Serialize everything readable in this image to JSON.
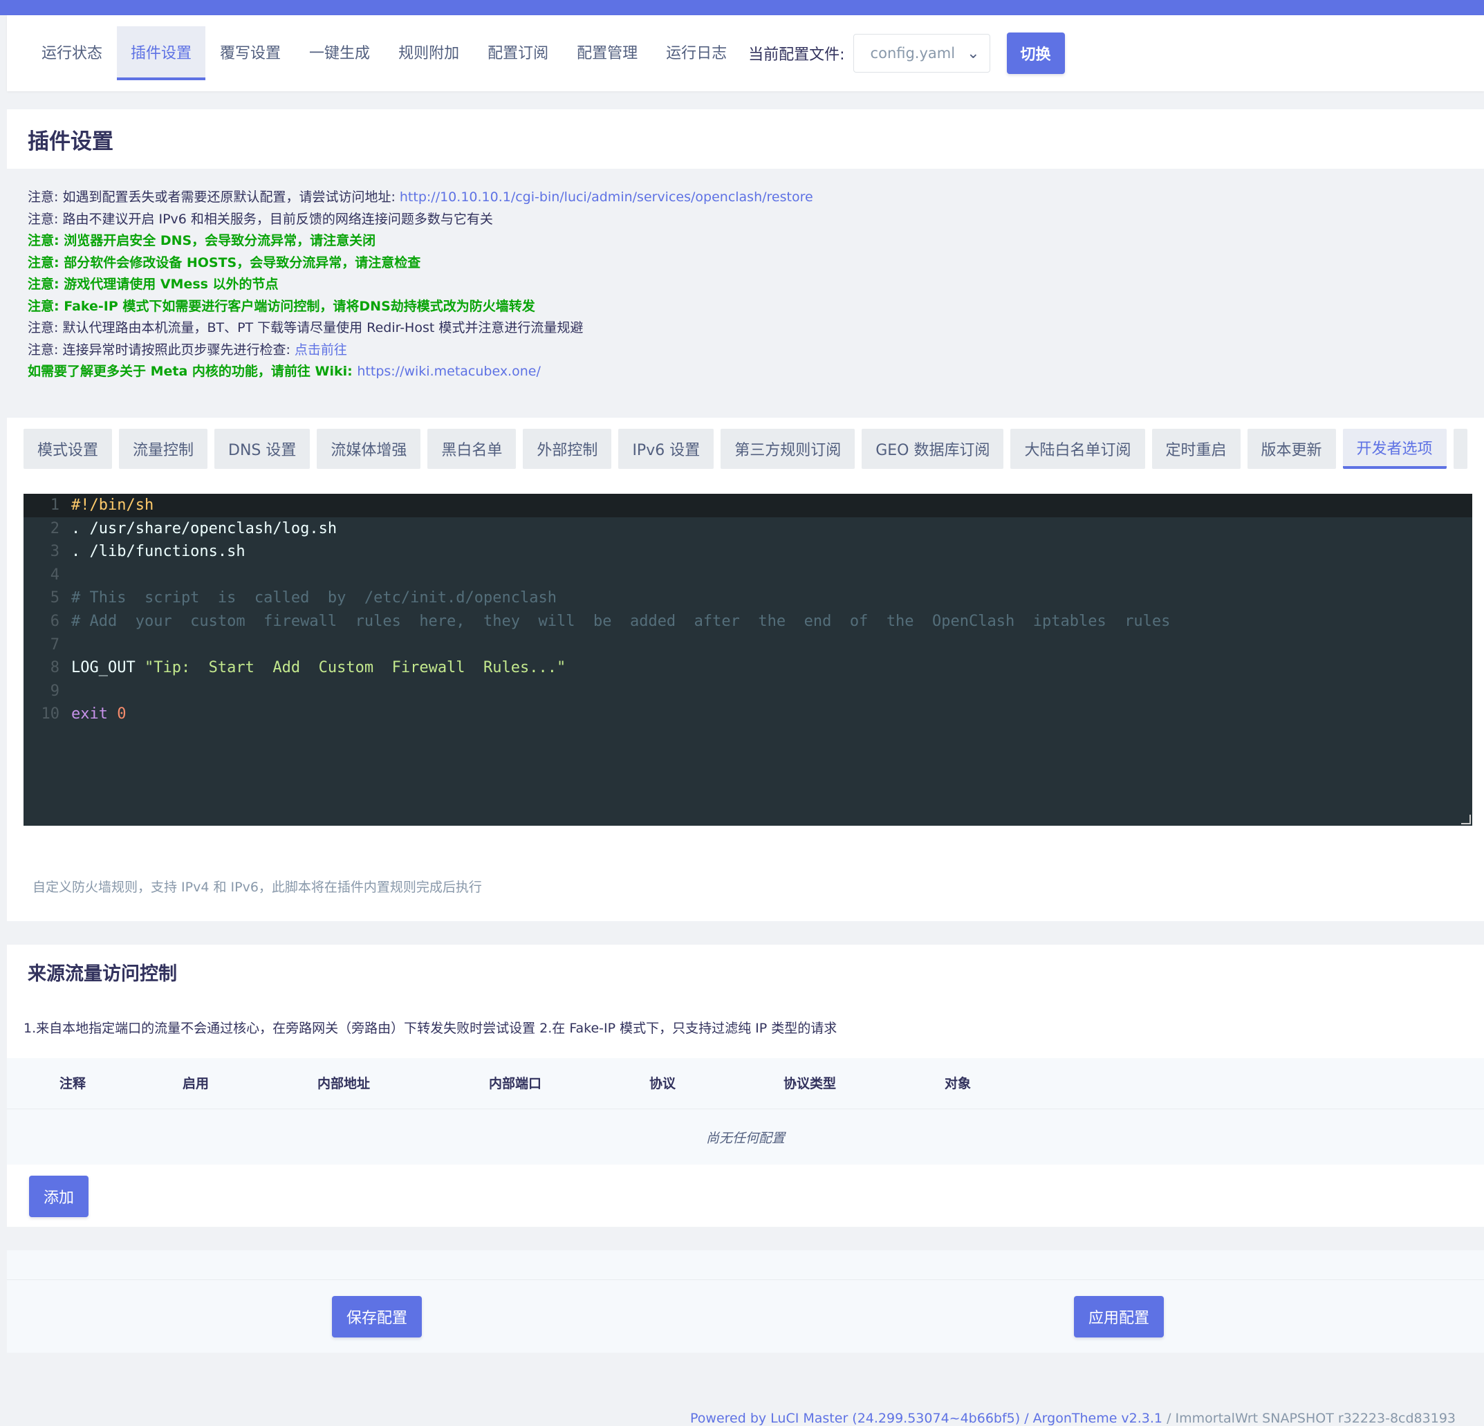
{
  "nav": {
    "tabs": [
      "运行状态",
      "插件设置",
      "覆写设置",
      "一键生成",
      "规则附加",
      "配置订阅",
      "配置管理",
      "运行日志"
    ],
    "active_tab": "插件设置",
    "config_label": "当前配置文件:",
    "config_value": "config.yaml",
    "switch_label": "切换"
  },
  "page": {
    "title": "插件设置"
  },
  "notes": [
    {
      "style": "normal",
      "text": "注意: 如遇到配置丢失或者需要还原默认配置，请尝试访问地址: ",
      "link": "http://10.10.10.1/cgi-bin/luci/admin/services/openclash/restore"
    },
    {
      "style": "normal",
      "text": "注意: 路由不建议开启 IPv6 和相关服务，目前反馈的网络连接问题多数与它有关",
      "link": ""
    },
    {
      "style": "green",
      "text": "注意: 浏览器开启安全 DNS，会导致分流异常，请注意关闭",
      "link": ""
    },
    {
      "style": "green",
      "text": "注意: 部分软件会修改设备 HOSTS，会导致分流异常，请注意检查",
      "link": ""
    },
    {
      "style": "green",
      "text": "注意: 游戏代理请使用 VMess 以外的节点",
      "link": ""
    },
    {
      "style": "green",
      "text": "注意: Fake-IP 模式下如需要进行客户端访问控制，请将DNS劫持模式改为防火墙转发",
      "link": ""
    },
    {
      "style": "normal",
      "text": "注意: 默认代理路由本机流量，BT、PT 下载等请尽量使用 Redir-Host 模式并注意进行流量规避",
      "link": ""
    },
    {
      "style": "normal",
      "text": "注意: 连接异常时请按照此页步骤先进行检查: ",
      "link": "点击前往"
    },
    {
      "style": "green",
      "text": "如需要了解更多关于 Meta 内核的功能，请前往 Wiki: ",
      "link": "https://wiki.metacubex.one/"
    }
  ],
  "subtabs": {
    "items": [
      "模式设置",
      "流量控制",
      "DNS 设置",
      "流媒体增强",
      "黑白名单",
      "外部控制",
      "IPv6 设置",
      "第三方规则订阅",
      "GEO 数据库订阅",
      "大陆白名单订阅",
      "定时重启",
      "版本更新",
      "开发者选项"
    ],
    "active": "开发者选项"
  },
  "editor": {
    "lines": [
      {
        "n": "1",
        "segments": [
          {
            "t": "#!/bin/sh",
            "c": "shebang"
          }
        ]
      },
      {
        "n": "2",
        "segments": [
          {
            "t": ". /usr/share/openclash/log.sh",
            "c": "plain"
          }
        ]
      },
      {
        "n": "3",
        "segments": [
          {
            "t": ". /lib/functions.sh",
            "c": "plain"
          }
        ]
      },
      {
        "n": "4",
        "segments": []
      },
      {
        "n": "5",
        "segments": [
          {
            "t": "# This  script  is  called  by  /etc/init.d/openclash",
            "c": "comment"
          }
        ]
      },
      {
        "n": "6",
        "segments": [
          {
            "t": "# Add  your  custom  firewall  rules  here,  they  will  be  added  after  the  end  of  the  OpenClash  iptables  rules",
            "c": "comment"
          }
        ]
      },
      {
        "n": "7",
        "segments": []
      },
      {
        "n": "8",
        "segments": [
          {
            "t": "LOG_OUT ",
            "c": "plain"
          },
          {
            "t": "\"Tip:  Start  Add  Custom  Firewall  Rules...\"",
            "c": "string"
          }
        ]
      },
      {
        "n": "9",
        "segments": []
      },
      {
        "n": "10",
        "segments": [
          {
            "t": "exit ",
            "c": "keyword"
          },
          {
            "t": "0",
            "c": "number"
          }
        ]
      }
    ],
    "help": "自定义防火墙规则，支持 IPv4 和 IPv6，此脚本将在插件内置规则完成后执行"
  },
  "traffic": {
    "title": "来源流量访问控制",
    "description": "1.来自本地指定端口的流量不会通过核心，在旁路网关（旁路由）下转发失败时尝试设置 2.在 Fake-IP 模式下，只支持过滤纯 IP 类型的请求",
    "columns": [
      "注释",
      "启用",
      "内部地址",
      "内部端口",
      "协议",
      "协议类型",
      "对象"
    ],
    "empty_text": "尚无任何配置",
    "add_label": "添加"
  },
  "actions": {
    "save_label": "保存配置",
    "apply_label": "应用配置"
  },
  "footer": {
    "powered_link": "Powered by LuCI Master (24.299.53074~4b66bf5)",
    "sep": " / ",
    "theme_link": "ArgonTheme v2.3.1",
    "system_text": " / ImmortalWrt SNAPSHOT r32223-8cd83193"
  },
  "colors": {
    "accent": "#5e72e4",
    "note_green": "#08a408",
    "editor_bg": "#263238"
  }
}
